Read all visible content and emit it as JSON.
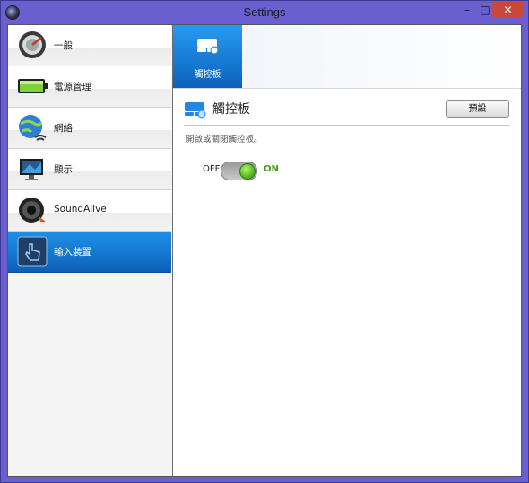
{
  "window": {
    "title": "Settings",
    "controls": {
      "minimize": "–",
      "maximize": "□",
      "close": "✕"
    }
  },
  "sidebar": {
    "items": [
      {
        "label": "一般",
        "icon": "general-gauge-icon",
        "selected": false
      },
      {
        "label": "電源管理",
        "icon": "battery-icon",
        "selected": false
      },
      {
        "label": "網絡",
        "icon": "globe-wifi-icon",
        "selected": false
      },
      {
        "label": "顯示",
        "icon": "monitor-icon",
        "selected": false
      },
      {
        "label": "SoundAlive",
        "icon": "speaker-icon",
        "selected": false
      },
      {
        "label": "輸入裝置",
        "icon": "touch-hand-icon",
        "selected": true
      }
    ]
  },
  "tabs": [
    {
      "label": "觸控板",
      "icon": "touchpad-icon",
      "selected": true
    }
  ],
  "section": {
    "title": "觸控板",
    "icon": "touchpad-icon",
    "default_button": "預設",
    "description": "開啟或關閉觸控板。"
  },
  "toggle": {
    "off_label": "OFF",
    "on_label": "ON",
    "state": "on"
  },
  "colors": {
    "accent_blue": "#1577d0",
    "on_green": "#3ea114",
    "window_frame": "#6a5fd0",
    "close_red": "#c9473b"
  }
}
